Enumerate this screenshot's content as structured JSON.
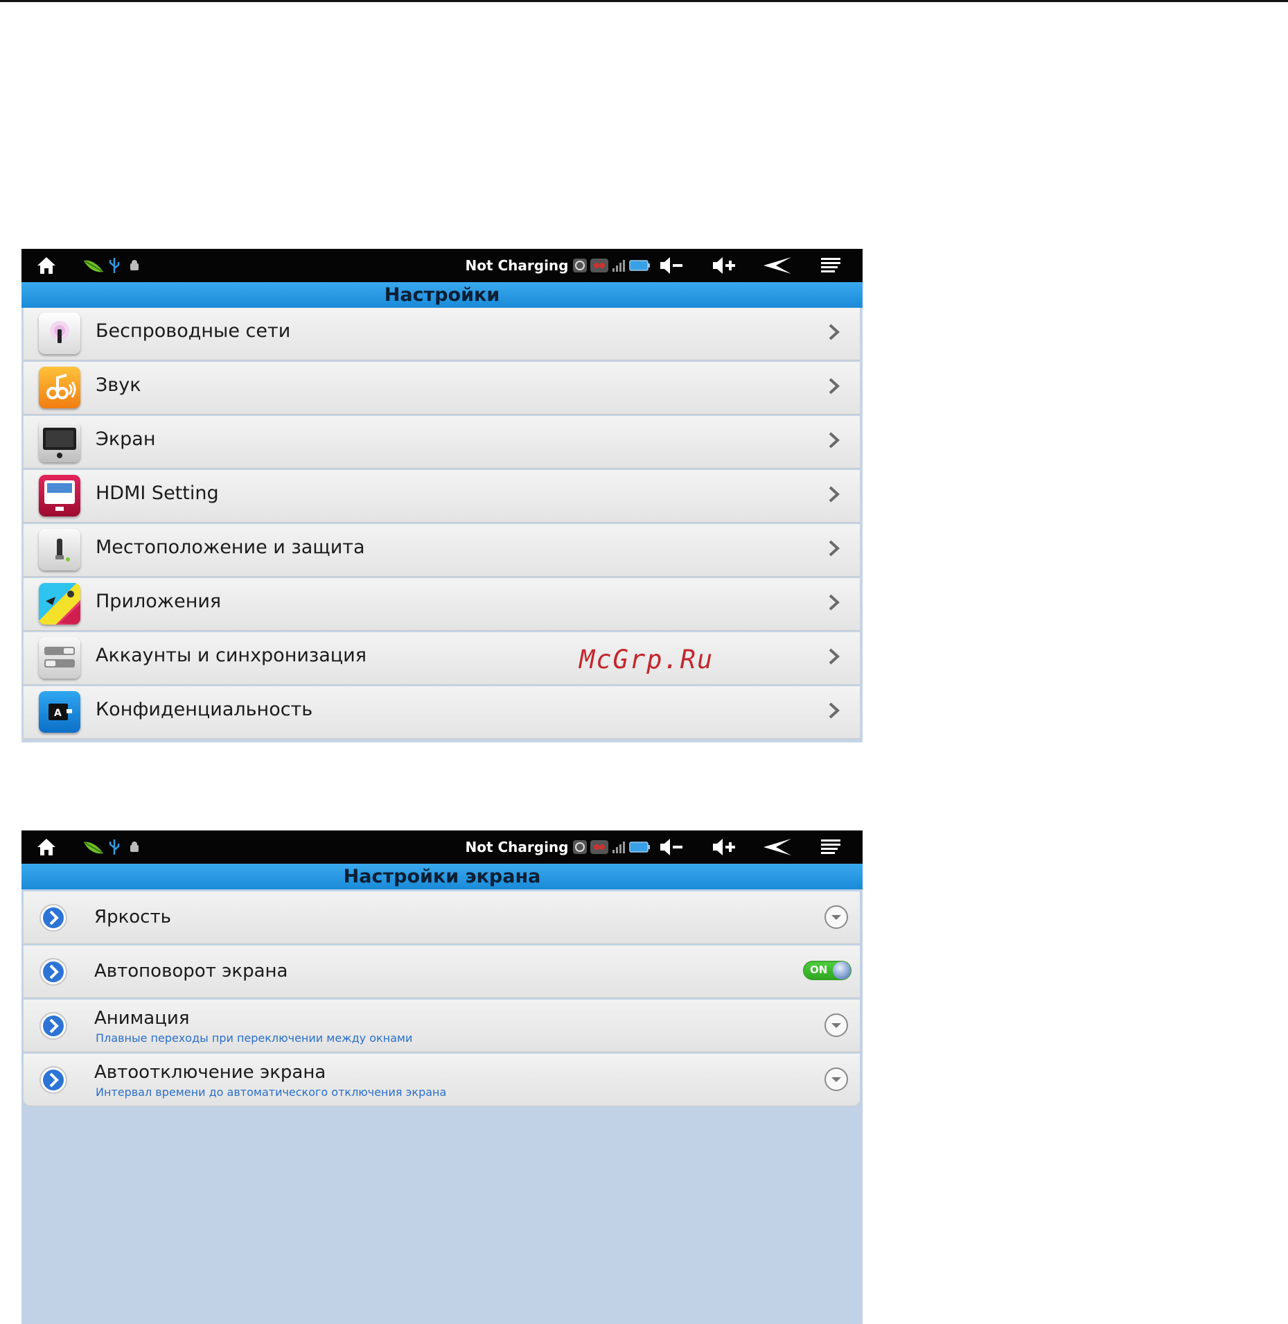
{
  "status_bar": {
    "charging_text": "Not Charging",
    "icons": [
      "home-icon",
      "leaf-icon",
      "usb-icon",
      "android-debug-icon",
      "sync-icon",
      "link-icon",
      "signal-icon",
      "battery-icon",
      "volume-down-icon",
      "volume-up-icon",
      "back-icon",
      "menu-icon"
    ]
  },
  "screen1": {
    "title": "Настройки",
    "items": [
      {
        "label": "Беспроводные сети",
        "icon": "wireless-icon"
      },
      {
        "label": "Звук",
        "icon": "sound-icon"
      },
      {
        "label": "Экран",
        "icon": "display-icon"
      },
      {
        "label": "HDMI Setting",
        "icon": "hdmi-icon"
      },
      {
        "label": "Местоположение и защита",
        "icon": "location-security-icon"
      },
      {
        "label": "Приложения",
        "icon": "applications-icon"
      },
      {
        "label": "Аккаунты и синхронизация",
        "icon": "accounts-sync-icon"
      },
      {
        "label": "Конфиденциальность",
        "icon": "privacy-icon"
      }
    ]
  },
  "screen2": {
    "title": "Настройки экрана",
    "items": [
      {
        "label": "Яркость",
        "subtitle": "",
        "control": "dropdown"
      },
      {
        "label": "Автоповорот экрана",
        "subtitle": "",
        "control": "toggle",
        "toggle_label": "ON"
      },
      {
        "label": "Анимация",
        "subtitle": "Плавные переходы при переключении между окнами",
        "control": "dropdown"
      },
      {
        "label": "Автоотключение экрана",
        "subtitle": "Интервал времени до автоматического отключения экрана",
        "control": "dropdown"
      }
    ]
  },
  "watermark": "McGrp.Ru",
  "colors": {
    "accent": "#1f94de",
    "statusbar": "#050505",
    "background": "#c5d4e6",
    "toggle_on": "#3cbf2e"
  }
}
